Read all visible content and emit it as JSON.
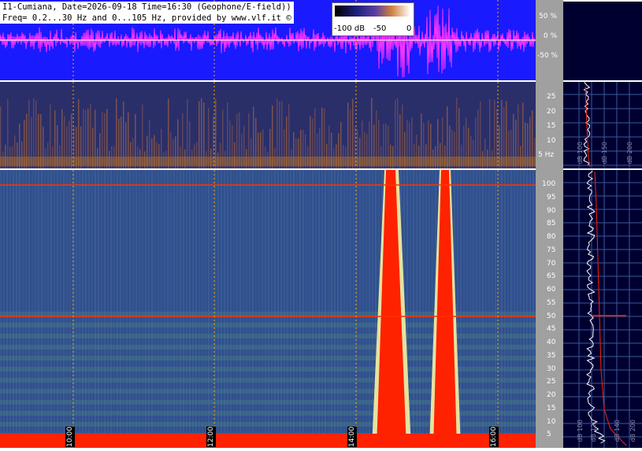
{
  "header": {
    "line1": "I1-Cumiana, Date=2026-09-18 Time=16:30 (Geophone/E-field))",
    "line2": "Freq= 0.2...30 Hz and 0...105 Hz, provided by www.vlf.it ©"
  },
  "colorbar": {
    "min_label": "-100 dB",
    "mid_label": "-50",
    "max_label": "0"
  },
  "wave_axis": {
    "ticks": [
      "50 %",
      "0 %",
      "-50 %"
    ]
  },
  "spec_low_axis": {
    "ticks": [
      "25",
      "20",
      "15",
      "10",
      "5 Hz"
    ]
  },
  "spec_high_axis": {
    "ticks": [
      "100",
      "95",
      "90",
      "85",
      "80",
      "75",
      "70",
      "65",
      "60",
      "55",
      "50",
      "45",
      "40",
      "35",
      "30",
      "25",
      "20",
      "15",
      "10",
      "5"
    ]
  },
  "time_labels": [
    "10:00",
    "12:00",
    "14:00",
    "16:00"
  ],
  "side_low_labels": [
    "dB 100",
    "dB 150",
    "dB 200"
  ],
  "side_high_labels": [
    "dB 100",
    "dB 120",
    "dB 140",
    "dB 200"
  ],
  "colors": {
    "wave_bg": "#1a1aff",
    "wave_trace": "#ff33ff",
    "marker": "#ff2200",
    "panel_bg": "#000030"
  }
}
